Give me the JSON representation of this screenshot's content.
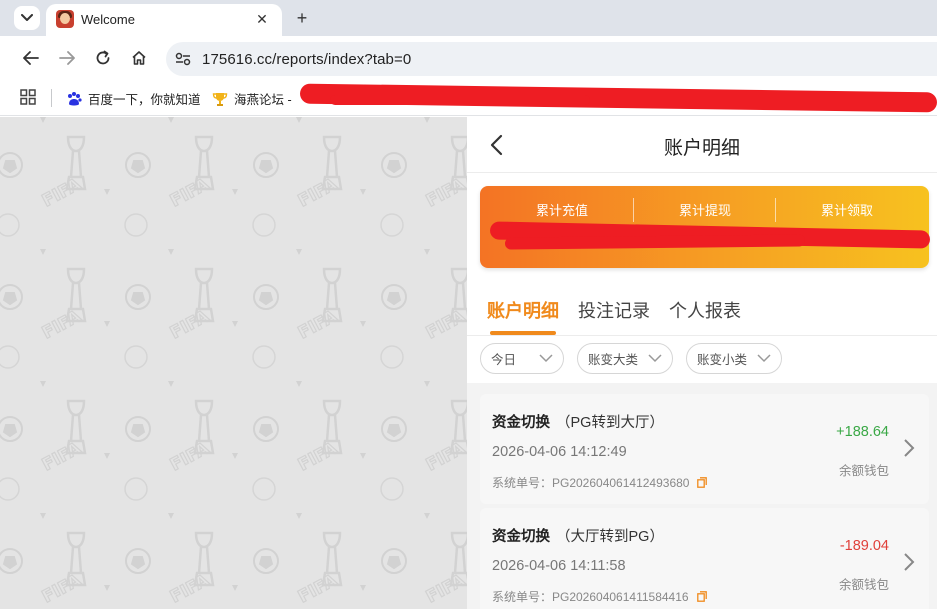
{
  "browser": {
    "tab_title": "Welcome",
    "tab_close": "✕",
    "new_tab": "+",
    "url": "175616.cc/reports/index?tab=0",
    "bookmarks": [
      {
        "label": "百度一下，你就知道"
      },
      {
        "label": "海燕论坛 -"
      }
    ]
  },
  "header": {
    "title": "账户明细"
  },
  "summary": {
    "columns": [
      {
        "label": "累计充值"
      },
      {
        "label": "累计提现"
      },
      {
        "label": "累计领取"
      }
    ]
  },
  "tabs": [
    {
      "label": "账户明细",
      "active": true
    },
    {
      "label": "投注记录",
      "active": false
    },
    {
      "label": "个人报表",
      "active": false
    }
  ],
  "filters": [
    {
      "label": "今日"
    },
    {
      "label": "账变大类"
    },
    {
      "label": "账变小类"
    }
  ],
  "records": [
    {
      "type": "资金切换",
      "detail": "（PG转到大厅）",
      "time": "2026-04-06 14:12:49",
      "order": "系统单号：PG202604061412493680",
      "amount": "+188.64",
      "wallet": "余额钱包"
    },
    {
      "type": "资金切换",
      "detail": "（大厅转到PG）",
      "time": "2026-04-06 14:11:58",
      "order": "系统单号：PG202604061411584416",
      "amount": "-189.04",
      "wallet": "余额钱包"
    }
  ],
  "colors": {
    "accent": "#f08a1c",
    "positive": "#3aa846",
    "negative": "#e0403a",
    "redaction": "#ee1d23"
  }
}
